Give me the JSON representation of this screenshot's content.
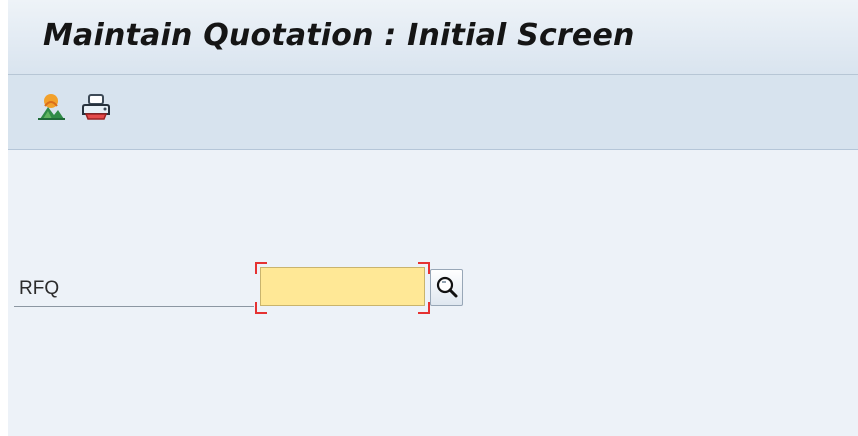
{
  "header": {
    "title": "Maintain Quotation : Initial Screen"
  },
  "toolbar": {
    "items": [
      {
        "icon": "vendor-landscape-icon"
      },
      {
        "icon": "printer-icon"
      }
    ]
  },
  "form": {
    "rfq_label": "RFQ",
    "rfq_value": "",
    "rfq_required": true,
    "rfq_field_color": "#ffe896"
  },
  "colors": {
    "title_bar": "#e8f0f7",
    "toolbar": "#d7e3ee",
    "content": "#edf2f8",
    "required_marker": "#e53232"
  }
}
